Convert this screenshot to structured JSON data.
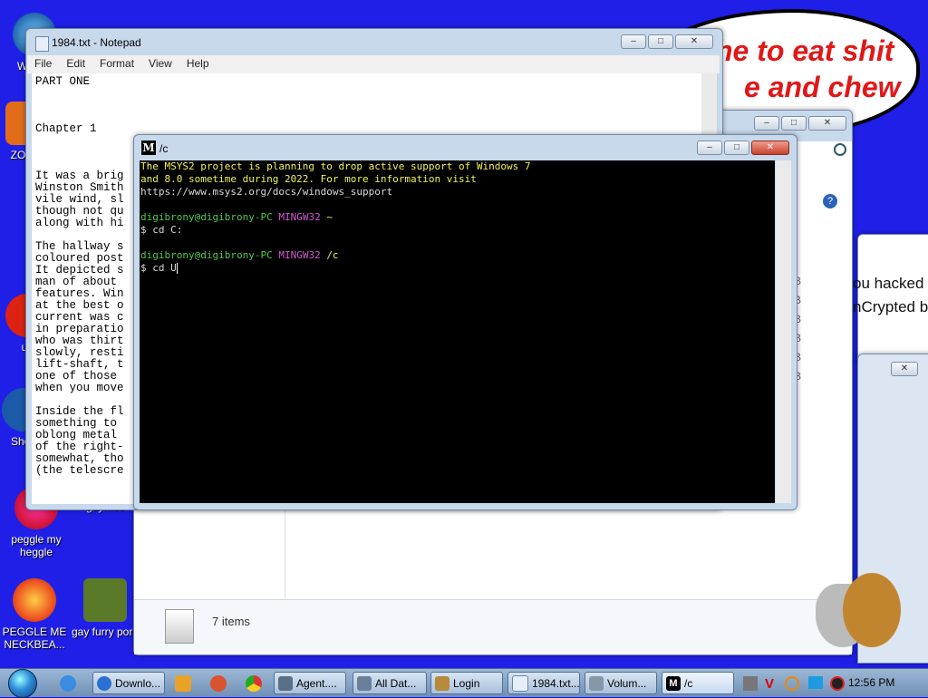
{
  "desktop": {
    "icons": [
      {
        "label": "peggle my heggle"
      },
      {
        "label": "gaymes"
      },
      {
        "label": "PEGGLE ME NECKBEA..."
      },
      {
        "label": "gay furry porn"
      },
      {
        "label": "WIN W"
      },
      {
        "label": "ZO DE"
      },
      {
        "label": "uk"
      },
      {
        "label": "Shop"
      }
    ],
    "bubble_lines": [
      "he to eat shit",
      "e and chew"
    ]
  },
  "notepad": {
    "title": "1984.txt - Notepad",
    "menu": [
      "File",
      "Edit",
      "Format",
      "View",
      "Help"
    ],
    "lines": [
      "PART ONE",
      "",
      "",
      "",
      "Chapter 1",
      "",
      "",
      "",
      "It was a brig",
      "Winston Smith",
      "vile wind, sl",
      "though not qu",
      "along with hi",
      "",
      "The hallway s",
      "coloured post",
      "It depicted s",
      "man of about",
      "features. Win",
      "at the best o",
      "current was c",
      "in preparatio",
      "who was thirt",
      "slowly, resti",
      "lift-shaft, t",
      "one of those",
      "when you move",
      "",
      "Inside the fl",
      "something to",
      "oblong metal",
      "of the right-",
      "somewhat, tho",
      "(the telescre"
    ]
  },
  "explorer": {
    "status_items": "7 items",
    "sizes": [
      "KB",
      "KB",
      "KB",
      "KB",
      "KB",
      "KB"
    ]
  },
  "right_window": {
    "text_line1": "ou hacked",
    "text_line2": "nCrypted b"
  },
  "terminal": {
    "title": "/c",
    "notice": [
      "The MSYS2 project is planning to drop active support of Windows 7",
      "and 8.0 sometime during 2022. For more information visit",
      "https://www.msys2.org/docs/windows_support"
    ],
    "prompt1_user": "digibrony@digibrony-PC",
    "prompt1_env": "MINGW32",
    "prompt1_path": "~",
    "cmd1": "$ cd C:",
    "prompt2_user": "digibrony@digibrony-PC",
    "prompt2_env": "MINGW32",
    "prompt2_path": "/c",
    "cmd2": "$ cd U"
  },
  "taskbar": {
    "items": [
      {
        "label": "Downlo..."
      },
      {
        "label": "Agent...."
      },
      {
        "label": "All Dat..."
      },
      {
        "label": "Login"
      },
      {
        "label": "1984.txt..."
      },
      {
        "label": "Volum..."
      },
      {
        "label": "/c"
      }
    ],
    "clock": "12:56 PM"
  }
}
